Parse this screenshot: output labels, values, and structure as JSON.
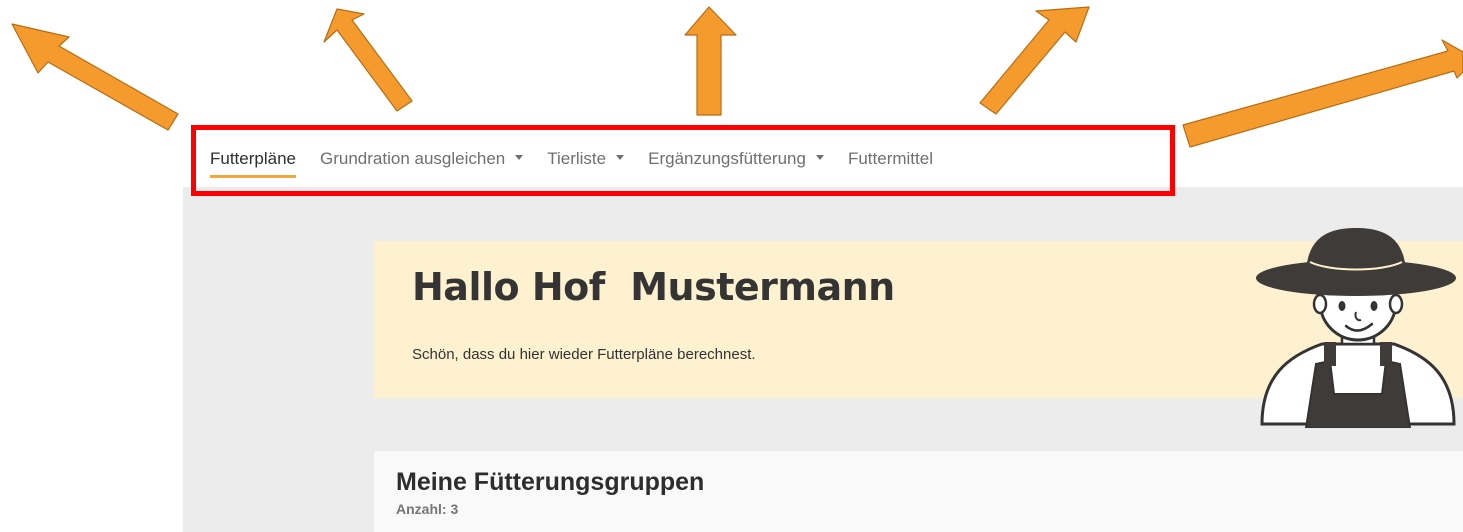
{
  "nav": {
    "items": [
      {
        "label": "Futterpläne",
        "active": true,
        "has_dropdown": false
      },
      {
        "label": "Grundration ausgleichen",
        "active": false,
        "has_dropdown": true
      },
      {
        "label": "Tierliste",
        "active": false,
        "has_dropdown": true
      },
      {
        "label": "Ergänzungsfütterung",
        "active": false,
        "has_dropdown": true
      },
      {
        "label": "Futtermittel",
        "active": false,
        "has_dropdown": false
      }
    ]
  },
  "greeting": {
    "title": "Hallo Hof  Mustermann",
    "subtitle": "Schön, dass du hier wieder Futterpläne berechnest."
  },
  "groups": {
    "title": "Meine Fütterungsgruppen",
    "count_label": "Anzahl: 3"
  },
  "colors": {
    "accent": "#f0a93a",
    "highlight": "#ff0000",
    "arrow": "#f59b2e",
    "banner": "#fdf1d0",
    "page_background": "#ececec"
  },
  "icons": {
    "avatar": "farmer-avatar",
    "dropdown": "caret-down-icon",
    "annotation": "arrow-icon"
  }
}
